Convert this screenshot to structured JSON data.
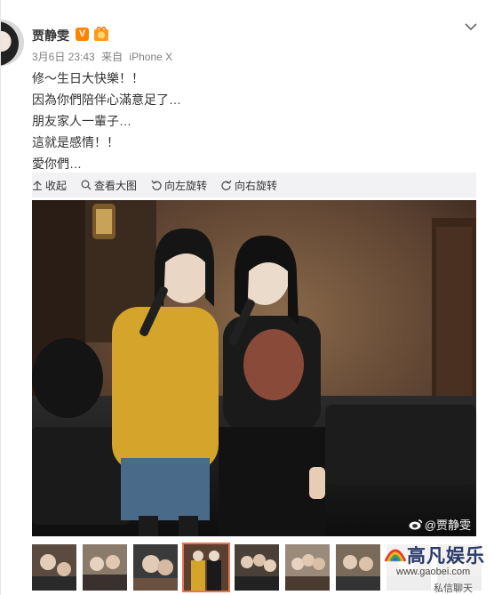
{
  "header": {
    "username": "贾静雯",
    "verified_badge": "V",
    "timestamp": "3月6日 23:43",
    "source_prefix": "来自",
    "source_device": "iPhone X"
  },
  "post": {
    "lines": [
      "修～生日大快樂！！",
      "因為你們陪伴心滿意足了…",
      "朋友家人一輩子…",
      "這就是感情！！",
      "愛你們…"
    ]
  },
  "toolbar": {
    "collapse_label": "收起",
    "view_large_label": "查看大图",
    "rotate_left_label": "向左旋转",
    "rotate_right_label": "向右旋转"
  },
  "photo": {
    "watermark": "@贾静雯"
  },
  "thumbnails": {
    "count": 9,
    "active_index": 3
  },
  "logo": {
    "title": "高凡娱乐",
    "url": "www.gaobei.com",
    "sub": "私信聊天"
  },
  "icons": {
    "chevron": "chevron-down-icon",
    "collapse": "arrow-up-icon",
    "view_large": "search-icon",
    "rotate_left": "rotate-left-icon",
    "rotate_right": "rotate-right-icon",
    "weibo": "weibo-icon"
  },
  "colors": {
    "accent_orange": "#ff8200",
    "active_thumb_border": "#eb7350",
    "toolbar_bg": "#f2f2f5",
    "meta_gray": "#808080"
  }
}
